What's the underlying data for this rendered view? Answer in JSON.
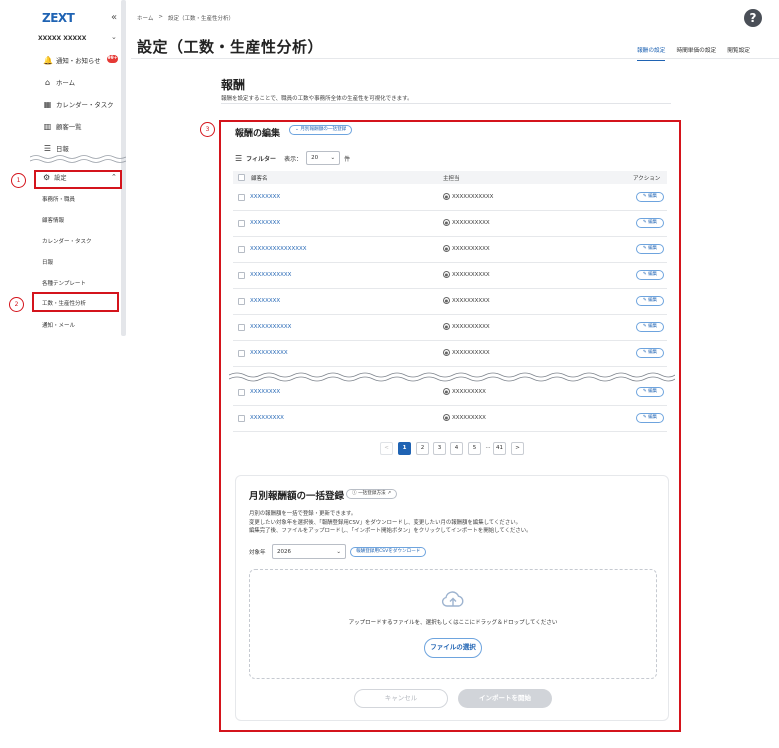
{
  "sidebar": {
    "logo": "ZEXT",
    "collapse_icon": "«",
    "account": "XXXXX XXXXX",
    "items": [
      {
        "label": "通知・お知らせ",
        "icon": "bell-icon",
        "badge": "99+"
      },
      {
        "label": "ホーム",
        "icon": "home-icon"
      },
      {
        "label": "カレンダー・タスク",
        "icon": "calendar-icon"
      },
      {
        "label": "顧客一覧",
        "icon": "building-icon"
      },
      {
        "label": "日報",
        "icon": "report-icon"
      }
    ],
    "settings_label": "設定",
    "sub_items": [
      "事務所・職員",
      "顧客情報",
      "カレンダー・タスク",
      "日報",
      "各種テンプレート",
      "工数・生産性分析",
      "通知・メール"
    ]
  },
  "markers": [
    "1",
    "2",
    "3"
  ],
  "header": {
    "breadcrumb": [
      "ホーム",
      ">",
      "設定（工数・生産性分析）"
    ],
    "title": "設定（工数・生産性分析）",
    "help": "?",
    "tabs": [
      "報酬の設定",
      "時間単価の設定",
      "閲覧設定"
    ]
  },
  "section": {
    "title": "報酬",
    "description": "報酬を設定することで、職員の工数や事務所全体の生産性を可視化できます。"
  },
  "edit": {
    "title": "報酬の編集",
    "bulk_toggle": "月別報酬額の一括登録",
    "filter_label": "フィルター",
    "display_label": "表示：",
    "display_value": "20",
    "display_unit": "件",
    "columns": [
      "顧客名",
      "主担当",
      "アクション"
    ],
    "rows": [
      {
        "client": "XXXXXXXX",
        "owner": "XXXXXXXXXXX"
      },
      {
        "client": "XXXXXXXX",
        "owner": "XXXXXXXXXX"
      },
      {
        "client": "XXXXXXXXXXXXXXX",
        "owner": "XXXXXXXXXX"
      },
      {
        "client": "XXXXXXXXXXX",
        "owner": "XXXXXXXXXX"
      },
      {
        "client": "XXXXXXXX",
        "owner": "XXXXXXXXXX"
      },
      {
        "client": "XXXXXXXXXXX",
        "owner": "XXXXXXXXXX"
      },
      {
        "client": "XXXXXXXXXX",
        "owner": "XXXXXXXXXX"
      },
      {
        "client": "XXXXXXXX",
        "owner": "XXXXXXXXX"
      },
      {
        "client": "XXXXXXXXX",
        "owner": "XXXXXXXXX"
      }
    ],
    "edit_label": "編集",
    "pagination": [
      "<",
      "1",
      "2",
      "3",
      "4",
      "5",
      "...",
      "41",
      ">"
    ]
  },
  "bulk": {
    "title": "月別報酬額の一括登録",
    "howto": "一括登録方法",
    "desc_lines": [
      "月別の報酬額を一括で登録・更新できます。",
      "変更したい対象年を選択後、「報酬登録用CSV」をダウンロードし、変更したい月の報酬額を編集してください。",
      "編集完了後、ファイルをアップロードし、「インポート開始ボタン」をクリックしてインポートを開始してください。"
    ],
    "year_label": "対象年",
    "year_value": "2026",
    "csv_button": "報酬登録用CSVをダウンロード",
    "drop_text": "アップロードするファイルを、選択もしくはここにドラッグ＆ドロップしてください",
    "file_button": "ファイルの選択",
    "cancel": "キャンセル",
    "import": "インポートを開始"
  }
}
